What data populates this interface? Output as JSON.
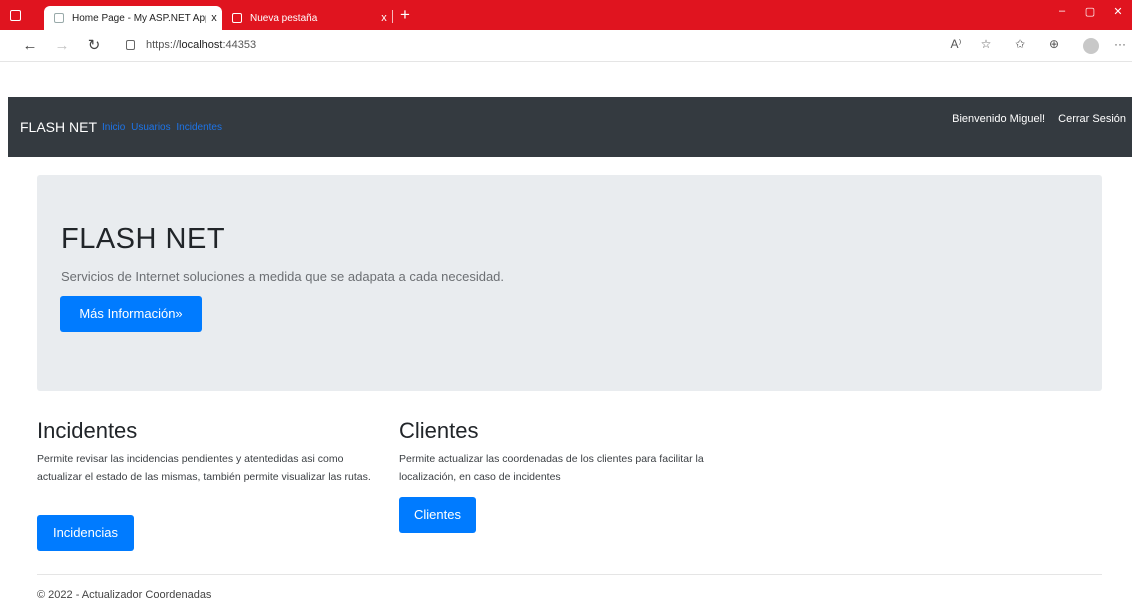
{
  "browser": {
    "tabs": [
      {
        "title": "Home Page - My ASP.NET Applic",
        "close": "x"
      },
      {
        "title": "Nueva pestaña",
        "close": "x"
      }
    ],
    "new_tab": "+",
    "url_scheme": "https://",
    "url_host": "localhost",
    "url_port": ":44353",
    "window_controls": {
      "minimize": "–",
      "maximize": "▢",
      "close": "✕"
    },
    "toolbar": {
      "read_aloud": "A⁾",
      "favorite": "☆",
      "favorites": "✩",
      "collections": "⊕",
      "more": "···"
    }
  },
  "navbar": {
    "brand": "FLASH NET",
    "links": [
      "Inicio",
      "Usuarios",
      "Incidentes"
    ],
    "welcome": "Bienvenido Miguel!",
    "logout": "Cerrar Sesión"
  },
  "jumbotron": {
    "title": "FLASH NET",
    "lead": "Servicios de Internet soluciones a medida que se adapata a cada necesidad.",
    "button": "Más Información»"
  },
  "sections": [
    {
      "title": "Incidentes",
      "text": "Permite revisar las incidencias pendientes y atentedidas asi como actualizar el estado de las mismas, también permite visualizar las rutas.",
      "button": "Incidencias"
    },
    {
      "title": "Clientes",
      "text": "Permite actualizar las coordenadas de los clientes para facilitar la localización, en caso de incidentes",
      "button": "Clientes"
    }
  ],
  "footer": "© 2022 - Actualizador Coordenadas",
  "colors": {
    "tabbar": "#e0141f",
    "navbar": "#343a40",
    "primary": "#007bff",
    "jumbotron": "#e9ecef"
  }
}
